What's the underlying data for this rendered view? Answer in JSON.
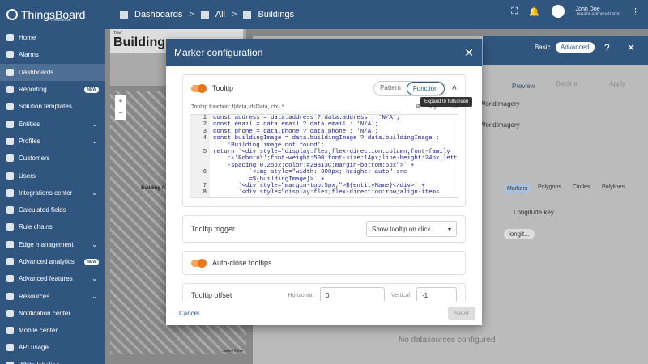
{
  "app": {
    "name": "ThingsBoard",
    "edition": "Professional"
  },
  "breadcrumb": [
    "Dashboards",
    "All",
    "Buildings"
  ],
  "user": {
    "name": "John Doe",
    "role": "Tenant administrator"
  },
  "sidebar": {
    "items": [
      {
        "label": "Home"
      },
      {
        "label": "Alarms"
      },
      {
        "label": "Dashboards"
      },
      {
        "label": "Reporting",
        "badge": "NEW"
      },
      {
        "label": "Solution templates"
      },
      {
        "label": "Entities"
      },
      {
        "label": "Profiles"
      },
      {
        "label": "Customers"
      },
      {
        "label": "Users"
      },
      {
        "label": "Integrations center"
      },
      {
        "label": "Calculated fields"
      },
      {
        "label": "Rule chains"
      },
      {
        "label": "Edge management"
      },
      {
        "label": "Advanced analytics",
        "badge": "NEW"
      },
      {
        "label": "Advanced features"
      },
      {
        "label": "Resources"
      },
      {
        "label": "Notification center"
      },
      {
        "label": "Mobile center"
      },
      {
        "label": "API usage"
      },
      {
        "label": "White labeling"
      }
    ]
  },
  "bg": {
    "title_label": "Title*",
    "title": "Buildings",
    "building_label": "Building A",
    "preview": "Preview",
    "decline": "Decline",
    "apply": "Apply",
    "basic": "Basic",
    "advanced": "Advanced",
    "layer1": "WorldImagery",
    "layer2": "WorldImagery",
    "tabs": [
      "Markers",
      "Polygons",
      "Circles",
      "Polylines"
    ],
    "longitude_key": "Longitude key",
    "longitude_chip": "longit...",
    "no_ds": "No datasources configured",
    "leaflet": "Leaflet | © Esri"
  },
  "modal": {
    "title": "Marker configuration",
    "tooltip_label": "Tooltip",
    "mode": [
      "Pattern",
      "Function"
    ],
    "fn_label": "Tooltip function: f(data, dsData, ctx) *",
    "tidy": "Tidy",
    "fullscreen_tip": "Expand to fullscreen",
    "code_lines": [
      {
        "n": "1",
        "t": "const address = data.address ? data.address : 'N/A';"
      },
      {
        "n": "2",
        "t": "const email = data.email ? data.email : 'N/A';"
      },
      {
        "n": "3",
        "t": "const phone = data.phone ? data.phone : 'N/A';"
      },
      {
        "n": "4",
        "t": "const buildingImage = data.buildingImage ? data.buildingImage :"
      },
      {
        "n": "",
        "t": "    'Building image not found';"
      },
      {
        "n": "5",
        "t": "return `<div style=\"display:flex;flex-direction:column;font-family"
      },
      {
        "n": "",
        "t": "    :\\'Roboto\\';font-weight:500;font-size:14px;line-height:24px;letter"
      },
      {
        "n": "",
        "t": "    -spacing:0.25px;color:#29313C;margin-bottom:5px\">` +"
      },
      {
        "n": "6",
        "t": "          `<img style=\"width: 300px; height: auto\" src"
      },
      {
        "n": "",
        "t": "          =${buildingImage}>` +"
      },
      {
        "n": "7",
        "t": "       `<div style=\"margin-top:5px;\">${entityName}</div>` +"
      },
      {
        "n": "8",
        "t": "       `<div style=\"display:flex;flex-direction:row;align-items"
      }
    ],
    "trigger_label": "Tooltip trigger",
    "trigger_value": "Show tooltip on click",
    "auto_close": "Auto-close tooltips",
    "offset_label": "Tooltip offset",
    "horizontal": "Horizontal",
    "horizontal_value": "0",
    "vertical": "Vertical",
    "vertical_value": "-1",
    "cancel": "Cancel",
    "save": "Save"
  }
}
